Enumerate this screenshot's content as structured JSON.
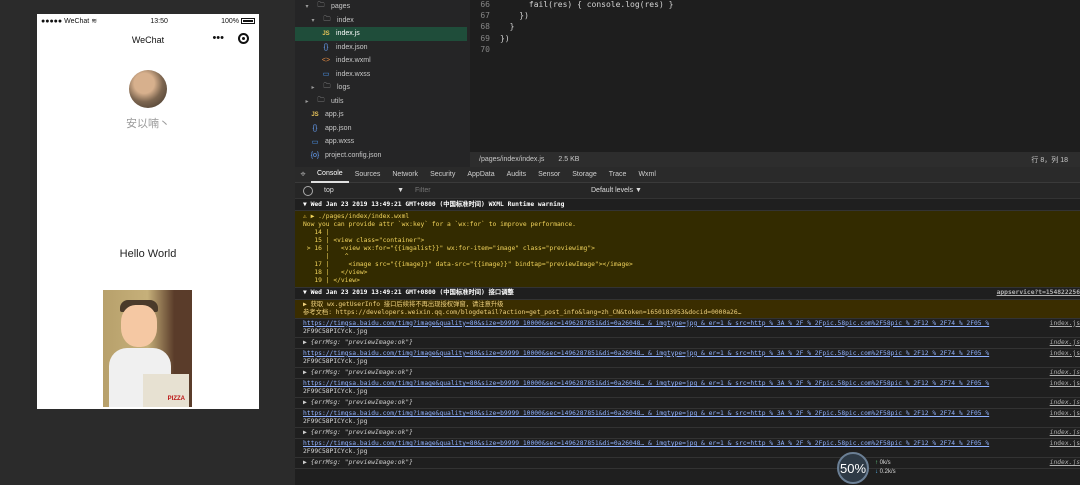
{
  "simulator": {
    "status": {
      "carrier": "●●●●● WeChat",
      "time": "13:50",
      "battery": "100%"
    },
    "nav_title": "WeChat",
    "more_label": "•••",
    "nickname": "安以喃丶",
    "hello": "Hello World",
    "cartoon_label": "PIZZA"
  },
  "filetree": {
    "items": [
      {
        "arrow": "▾",
        "icon": "folder",
        "label": "pages"
      },
      {
        "arrow": "▾",
        "icon": "folder",
        "label": "index"
      },
      {
        "arrow": "",
        "icon": "js",
        "label": "index.js"
      },
      {
        "arrow": "",
        "icon": "json",
        "label": "index.json"
      },
      {
        "arrow": "",
        "icon": "wxml",
        "label": "index.wxml"
      },
      {
        "arrow": "",
        "icon": "wxss",
        "label": "index.wxss"
      },
      {
        "arrow": "▸",
        "icon": "folder",
        "label": "logs"
      },
      {
        "arrow": "▸",
        "icon": "folder",
        "label": "utils"
      },
      {
        "arrow": "",
        "icon": "js",
        "label": "app.js"
      },
      {
        "arrow": "",
        "icon": "json",
        "label": "app.json"
      },
      {
        "arrow": "",
        "icon": "wxss",
        "label": "app.wxss"
      },
      {
        "arrow": "",
        "icon": "json",
        "label": "project.config.json"
      }
    ]
  },
  "editor": {
    "lines": [
      {
        "n": "66",
        "t": "      fail(res) { console.log(res) }"
      },
      {
        "n": "67",
        "t": "    })"
      },
      {
        "n": "68",
        "t": "  }"
      },
      {
        "n": "69",
        "t": "})"
      },
      {
        "n": "70",
        "t": ""
      }
    ],
    "status": {
      "path": "/pages/index/index.js",
      "size": "2.5 KB",
      "cursor": "行 8，列 18"
    }
  },
  "devtools": {
    "tabs": [
      "Console",
      "Sources",
      "Network",
      "Security",
      "AppData",
      "Audits",
      "Sensor",
      "Storage",
      "Trace",
      "Wxml"
    ],
    "context": "top",
    "filter_placeholder": "Filter",
    "levels": "Default levels ▼",
    "messages": {
      "m1_header": "▼ Wed Jan 23 2019 13:49:21 GMT+0800 (中国标准时间) WXML Runtime warning",
      "m1_path": "▶ ./pages/index/index.wxml",
      "m1_note": "Now you can provide attr `wx:key` for a `wx:for` to improve performance.",
      "m1_code": [
        "   14 |",
        "   15 | <view class=\"container\">",
        " > 16 |   <view wx:for=\"{{imgalist}}\" wx:for-item=\"image\" class=\"previewimg\">",
        "      |    ^",
        "   17 |     <image src=\"{{image}}\" data-src=\"{{image}}\" bindtap=\"previewImage\"></image>",
        "   18 |   </view>",
        "   19 | </view>"
      ],
      "m2_header": "▼ Wed Jan 23 2019 13:49:21 GMT+0800 (中国标准时间) 接口调整",
      "m2_right": "appservice?t=154822256",
      "m2_line1": "▶ 获取 wx.getUserInfo 接口后续将不再出现授权弹窗，请注意升级",
      "m2_line2": "参考文档: https://developers.weixin.qq.com/blogdetail?action=get_post_info&lang=zh_CN&token=1650183953&docid=0000a26…",
      "url_long": "https://timgsa.baidu.com/timg?image&quality=80&size=b9999_10000&sec=1496287851&di=0a26048… & imgtype=jpg & er=1 & src=http % 3A % 2F % 2Fpic.58pic.com%2F58pic % 2F12 % 2F74 % 2F05 %",
      "url_tail": "2F99C58PICYck.jpg",
      "url_right": "index.js",
      "obj": "▶ {errMsg: \"previewImage:ok\"}"
    }
  },
  "perf": {
    "percent": "50%",
    "up": "0k/s",
    "down": "0.2k/s"
  }
}
